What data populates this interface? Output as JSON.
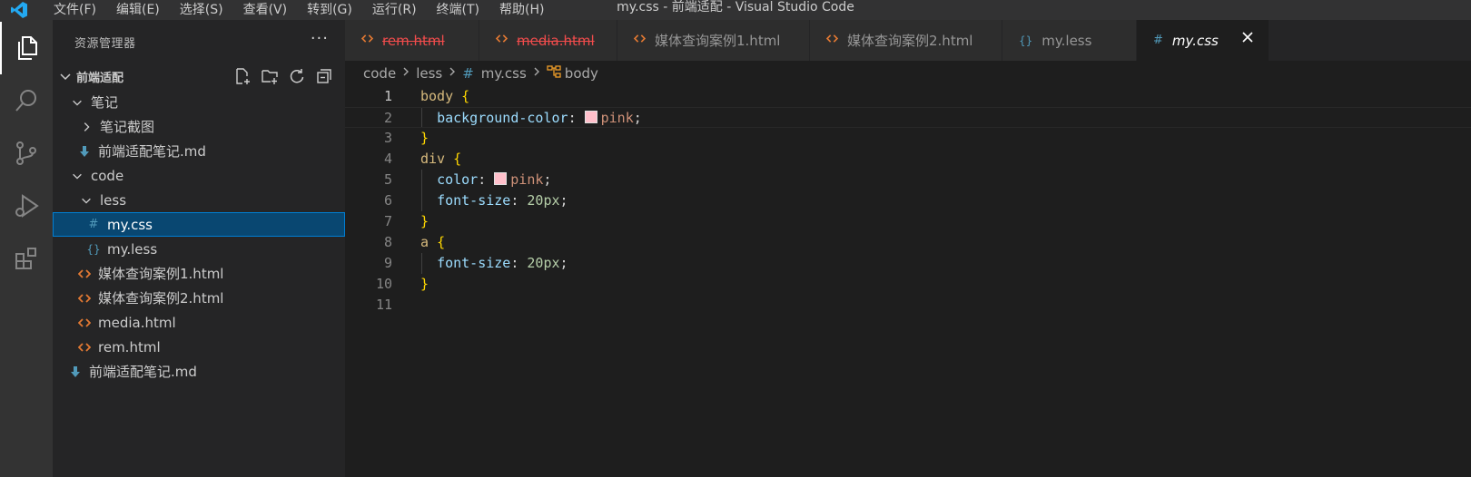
{
  "window": {
    "title": "my.css - 前端适配 - Visual Studio Code",
    "menu": [
      "文件(F)",
      "编辑(E)",
      "选择(S)",
      "查看(V)",
      "转到(G)",
      "运行(R)",
      "终端(T)",
      "帮助(H)"
    ]
  },
  "colors": {
    "accent": "#007acc",
    "selected_row": "#094771",
    "deleted": "#f14c4c",
    "html_icon": "#e37933",
    "css_icon": "#519aba",
    "less_icon": "#519aba",
    "md_icon": "#519aba",
    "swatch_pink": "#ffc0cb"
  },
  "activitybar": {
    "items": [
      {
        "name": "explorer",
        "icon": "files-icon"
      },
      {
        "name": "search",
        "icon": "search-icon"
      },
      {
        "name": "source-control",
        "icon": "source-control-icon"
      },
      {
        "name": "run-debug",
        "icon": "run-debug-icon"
      },
      {
        "name": "extensions",
        "icon": "extensions-icon"
      }
    ]
  },
  "sidebar": {
    "title": "资源管理器",
    "more": "···",
    "folder": "前端适配",
    "tree": [
      {
        "label": "笔记",
        "type": "folder-open",
        "depth": 1
      },
      {
        "label": "笔记截图",
        "type": "folder-closed",
        "depth": 2
      },
      {
        "label": "前端适配笔记.md",
        "type": "md",
        "depth": 2
      },
      {
        "label": "code",
        "type": "folder-open",
        "depth": 1
      },
      {
        "label": "less",
        "type": "folder-open",
        "depth": 2
      },
      {
        "label": "my.css",
        "type": "css",
        "depth": 3,
        "selected": true
      },
      {
        "label": "my.less",
        "type": "less",
        "depth": 3
      },
      {
        "label": "媒体查询案例1.html",
        "type": "html",
        "depth": 2
      },
      {
        "label": "媒体查询案例2.html",
        "type": "html",
        "depth": 2
      },
      {
        "label": "media.html",
        "type": "html",
        "depth": 2
      },
      {
        "label": "rem.html",
        "type": "html",
        "depth": 2
      },
      {
        "label": "前端适配笔记.md",
        "type": "md",
        "depth": 1
      }
    ]
  },
  "tabs": [
    {
      "label": "rem.html",
      "type": "html",
      "deleted": true
    },
    {
      "label": "media.html",
      "type": "html",
      "deleted": true
    },
    {
      "label": "媒体查询案例1.html",
      "type": "html"
    },
    {
      "label": "媒体查询案例2.html",
      "type": "html"
    },
    {
      "label": "my.less",
      "type": "less"
    },
    {
      "label": "my.css",
      "type": "css",
      "active": true
    }
  ],
  "breadcrumb": [
    "code",
    "less",
    "my.css",
    "body"
  ],
  "editor": {
    "line_numbers": [
      "1",
      "2",
      "3",
      "4",
      "5",
      "6",
      "7",
      "8",
      "9",
      "10",
      "11"
    ],
    "lines": [
      [
        {
          "t": "body",
          "c": "sel"
        },
        {
          "t": " ",
          "c": "punc"
        },
        {
          "t": "{",
          "c": "brace"
        }
      ],
      [
        {
          "t": "  ",
          "c": "punc"
        },
        {
          "t": "background-color",
          "c": "prop"
        },
        {
          "t": ": ",
          "c": "punc"
        },
        {
          "t": "",
          "c": "swatch"
        },
        {
          "t": "pink",
          "c": "val"
        },
        {
          "t": ";",
          "c": "punc"
        }
      ],
      [
        {
          "t": "}",
          "c": "brace"
        }
      ],
      [
        {
          "t": "div",
          "c": "sel"
        },
        {
          "t": " ",
          "c": "punc"
        },
        {
          "t": "{",
          "c": "brace"
        }
      ],
      [
        {
          "t": "  ",
          "c": "punc"
        },
        {
          "t": "color",
          "c": "prop"
        },
        {
          "t": ": ",
          "c": "punc"
        },
        {
          "t": "",
          "c": "swatch"
        },
        {
          "t": "pink",
          "c": "val"
        },
        {
          "t": ";",
          "c": "punc"
        }
      ],
      [
        {
          "t": "  ",
          "c": "punc"
        },
        {
          "t": "font-size",
          "c": "prop"
        },
        {
          "t": ": ",
          "c": "punc"
        },
        {
          "t": "20px",
          "c": "num"
        },
        {
          "t": ";",
          "c": "punc"
        }
      ],
      [
        {
          "t": "}",
          "c": "brace"
        }
      ],
      [
        {
          "t": "a",
          "c": "sel"
        },
        {
          "t": " ",
          "c": "punc"
        },
        {
          "t": "{",
          "c": "brace"
        }
      ],
      [
        {
          "t": "  ",
          "c": "punc"
        },
        {
          "t": "font-size",
          "c": "prop"
        },
        {
          "t": ": ",
          "c": "punc"
        },
        {
          "t": "20px",
          "c": "num"
        },
        {
          "t": ";",
          "c": "punc"
        }
      ],
      [
        {
          "t": "}",
          "c": "brace"
        }
      ],
      []
    ]
  }
}
